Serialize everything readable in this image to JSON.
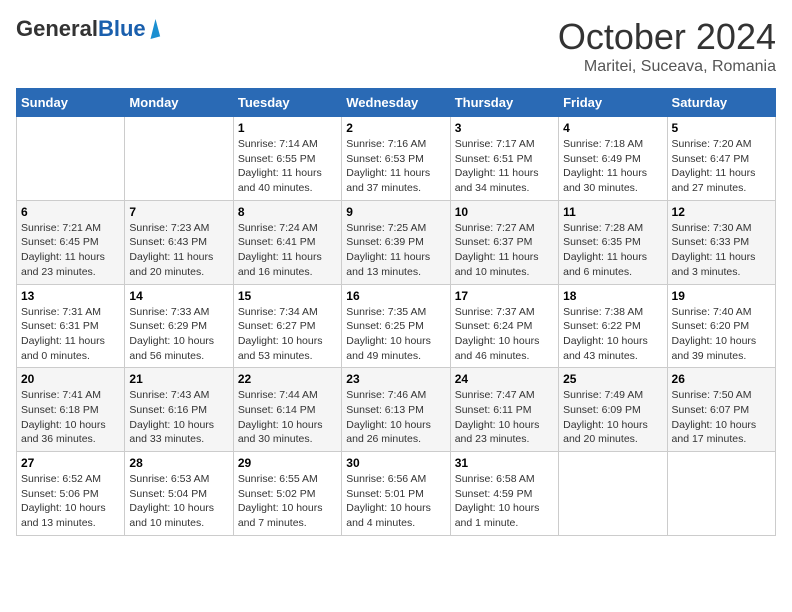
{
  "header": {
    "logo_general": "General",
    "logo_blue": "Blue",
    "title": "October 2024",
    "subtitle": "Maritei, Suceava, Romania"
  },
  "weekdays": [
    "Sunday",
    "Monday",
    "Tuesday",
    "Wednesday",
    "Thursday",
    "Friday",
    "Saturday"
  ],
  "weeks": [
    [
      {
        "day": "",
        "info": ""
      },
      {
        "day": "",
        "info": ""
      },
      {
        "day": "1",
        "info": "Sunrise: 7:14 AM\nSunset: 6:55 PM\nDaylight: 11 hours and 40 minutes."
      },
      {
        "day": "2",
        "info": "Sunrise: 7:16 AM\nSunset: 6:53 PM\nDaylight: 11 hours and 37 minutes."
      },
      {
        "day": "3",
        "info": "Sunrise: 7:17 AM\nSunset: 6:51 PM\nDaylight: 11 hours and 34 minutes."
      },
      {
        "day": "4",
        "info": "Sunrise: 7:18 AM\nSunset: 6:49 PM\nDaylight: 11 hours and 30 minutes."
      },
      {
        "day": "5",
        "info": "Sunrise: 7:20 AM\nSunset: 6:47 PM\nDaylight: 11 hours and 27 minutes."
      }
    ],
    [
      {
        "day": "6",
        "info": "Sunrise: 7:21 AM\nSunset: 6:45 PM\nDaylight: 11 hours and 23 minutes."
      },
      {
        "day": "7",
        "info": "Sunrise: 7:23 AM\nSunset: 6:43 PM\nDaylight: 11 hours and 20 minutes."
      },
      {
        "day": "8",
        "info": "Sunrise: 7:24 AM\nSunset: 6:41 PM\nDaylight: 11 hours and 16 minutes."
      },
      {
        "day": "9",
        "info": "Sunrise: 7:25 AM\nSunset: 6:39 PM\nDaylight: 11 hours and 13 minutes."
      },
      {
        "day": "10",
        "info": "Sunrise: 7:27 AM\nSunset: 6:37 PM\nDaylight: 11 hours and 10 minutes."
      },
      {
        "day": "11",
        "info": "Sunrise: 7:28 AM\nSunset: 6:35 PM\nDaylight: 11 hours and 6 minutes."
      },
      {
        "day": "12",
        "info": "Sunrise: 7:30 AM\nSunset: 6:33 PM\nDaylight: 11 hours and 3 minutes."
      }
    ],
    [
      {
        "day": "13",
        "info": "Sunrise: 7:31 AM\nSunset: 6:31 PM\nDaylight: 11 hours and 0 minutes."
      },
      {
        "day": "14",
        "info": "Sunrise: 7:33 AM\nSunset: 6:29 PM\nDaylight: 10 hours and 56 minutes."
      },
      {
        "day": "15",
        "info": "Sunrise: 7:34 AM\nSunset: 6:27 PM\nDaylight: 10 hours and 53 minutes."
      },
      {
        "day": "16",
        "info": "Sunrise: 7:35 AM\nSunset: 6:25 PM\nDaylight: 10 hours and 49 minutes."
      },
      {
        "day": "17",
        "info": "Sunrise: 7:37 AM\nSunset: 6:24 PM\nDaylight: 10 hours and 46 minutes."
      },
      {
        "day": "18",
        "info": "Sunrise: 7:38 AM\nSunset: 6:22 PM\nDaylight: 10 hours and 43 minutes."
      },
      {
        "day": "19",
        "info": "Sunrise: 7:40 AM\nSunset: 6:20 PM\nDaylight: 10 hours and 39 minutes."
      }
    ],
    [
      {
        "day": "20",
        "info": "Sunrise: 7:41 AM\nSunset: 6:18 PM\nDaylight: 10 hours and 36 minutes."
      },
      {
        "day": "21",
        "info": "Sunrise: 7:43 AM\nSunset: 6:16 PM\nDaylight: 10 hours and 33 minutes."
      },
      {
        "day": "22",
        "info": "Sunrise: 7:44 AM\nSunset: 6:14 PM\nDaylight: 10 hours and 30 minutes."
      },
      {
        "day": "23",
        "info": "Sunrise: 7:46 AM\nSunset: 6:13 PM\nDaylight: 10 hours and 26 minutes."
      },
      {
        "day": "24",
        "info": "Sunrise: 7:47 AM\nSunset: 6:11 PM\nDaylight: 10 hours and 23 minutes."
      },
      {
        "day": "25",
        "info": "Sunrise: 7:49 AM\nSunset: 6:09 PM\nDaylight: 10 hours and 20 minutes."
      },
      {
        "day": "26",
        "info": "Sunrise: 7:50 AM\nSunset: 6:07 PM\nDaylight: 10 hours and 17 minutes."
      }
    ],
    [
      {
        "day": "27",
        "info": "Sunrise: 6:52 AM\nSunset: 5:06 PM\nDaylight: 10 hours and 13 minutes."
      },
      {
        "day": "28",
        "info": "Sunrise: 6:53 AM\nSunset: 5:04 PM\nDaylight: 10 hours and 10 minutes."
      },
      {
        "day": "29",
        "info": "Sunrise: 6:55 AM\nSunset: 5:02 PM\nDaylight: 10 hours and 7 minutes."
      },
      {
        "day": "30",
        "info": "Sunrise: 6:56 AM\nSunset: 5:01 PM\nDaylight: 10 hours and 4 minutes."
      },
      {
        "day": "31",
        "info": "Sunrise: 6:58 AM\nSunset: 4:59 PM\nDaylight: 10 hours and 1 minute."
      },
      {
        "day": "",
        "info": ""
      },
      {
        "day": "",
        "info": ""
      }
    ]
  ]
}
